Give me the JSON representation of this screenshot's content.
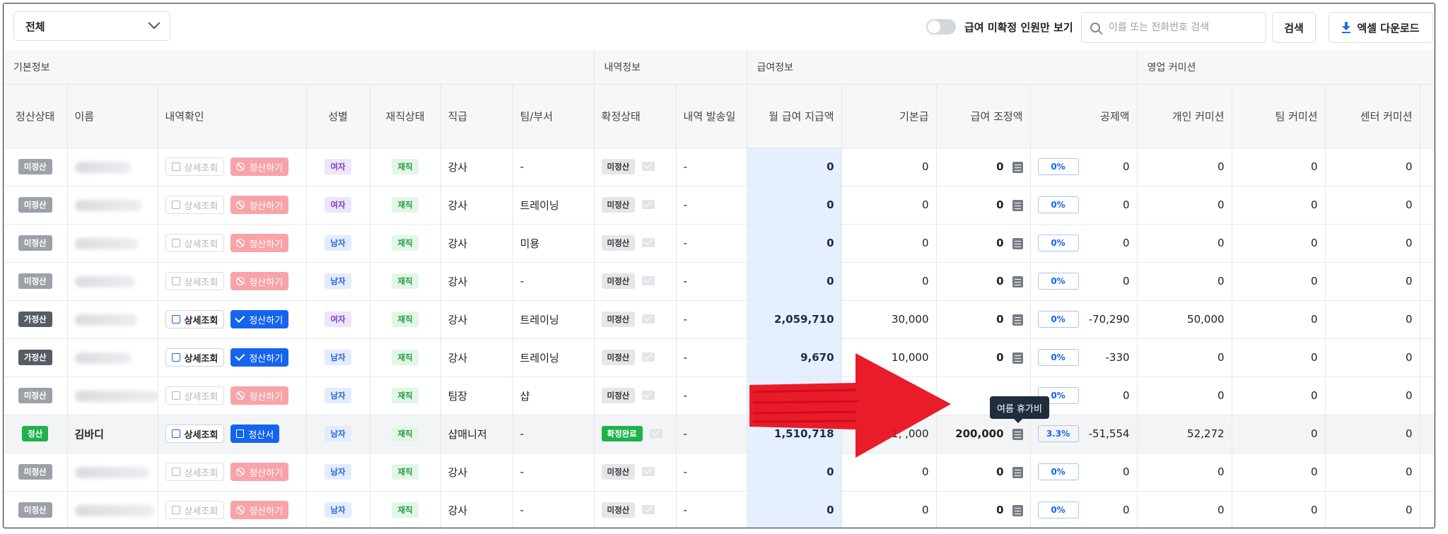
{
  "filter": {
    "selected": "전체"
  },
  "toggle": {
    "label": "급여 미확정 인원만 보기"
  },
  "search": {
    "placeholder": "이름 또는 전화번호 검색",
    "button_label": "검색"
  },
  "excel": {
    "label": "엑셀 다운로드"
  },
  "groups": [
    "기본정보",
    "내역정보",
    "급여정보",
    "영업 커미션"
  ],
  "columns": [
    "정산상태",
    "이름",
    "내역확인",
    "성별",
    "재직상태",
    "직급",
    "팀/부서",
    "확정상태",
    "내역 발송일",
    "월 급여 지급액",
    "기본급",
    "급여 조정액",
    "공제액",
    "개인 커미션",
    "팀 커미션",
    "센터 커미션"
  ],
  "action_labels": {
    "detail": "상세조회",
    "settle": "정산하기",
    "statement": "정산서"
  },
  "rows": [
    {
      "status": "미정산",
      "name": "",
      "gender": "여자",
      "emp": "재직",
      "rank": "강사",
      "team": "-",
      "confirm": "미정산",
      "sent": "-",
      "pay": "0",
      "base": "0",
      "adj": "0",
      "pct": "0%",
      "ded": "0",
      "pc": "0",
      "tc": "0",
      "cc": "0"
    },
    {
      "status": "미정산",
      "name": "",
      "gender": "여자",
      "emp": "재직",
      "rank": "강사",
      "team": "트레이닝",
      "confirm": "미정산",
      "sent": "-",
      "pay": "0",
      "base": "0",
      "adj": "0",
      "pct": "0%",
      "ded": "0",
      "pc": "0",
      "tc": "0",
      "cc": "0"
    },
    {
      "status": "미정산",
      "name": "",
      "gender": "남자",
      "emp": "재직",
      "rank": "강사",
      "team": "미용",
      "confirm": "미정산",
      "sent": "-",
      "pay": "0",
      "base": "0",
      "adj": "0",
      "pct": "0%",
      "ded": "0",
      "pc": "0",
      "tc": "0",
      "cc": "0"
    },
    {
      "status": "미정산",
      "name": "",
      "gender": "남자",
      "emp": "재직",
      "rank": "강사",
      "team": "-",
      "confirm": "미정산",
      "sent": "-",
      "pay": "0",
      "base": "0",
      "adj": "0",
      "pct": "0%",
      "ded": "0",
      "pc": "0",
      "tc": "0",
      "cc": "0"
    },
    {
      "status": "가정산",
      "name": "",
      "gender": "여자",
      "emp": "재직",
      "rank": "강사",
      "team": "트레이닝",
      "confirm": "미정산",
      "sent": "-",
      "pay": "2,059,710",
      "base": "30,000",
      "adj": "0",
      "pct": "0%",
      "ded": "-70,290",
      "pc": "50,000",
      "tc": "0",
      "cc": "0"
    },
    {
      "status": "가정산",
      "name": "",
      "gender": "남자",
      "emp": "재직",
      "rank": "강사",
      "team": "트레이닝",
      "confirm": "미정산",
      "sent": "-",
      "pay": "9,670",
      "base": "10,000",
      "adj": "0",
      "pct": "0%",
      "ded": "-330",
      "pc": "0",
      "tc": "0",
      "cc": "0"
    },
    {
      "status": "미정산",
      "name": "",
      "gender": "남자",
      "emp": "재직",
      "rank": "팀장",
      "team": "샵",
      "confirm": "미정산",
      "sent": "-",
      "pay": "",
      "base": "",
      "adj": "",
      "pct": "0%",
      "ded": "0",
      "pc": "0",
      "tc": "0",
      "cc": "0"
    },
    {
      "status": "정산",
      "name": "김바디",
      "gender": "남자",
      "emp": "재직",
      "rank": "샵매니저",
      "team": "-",
      "confirm": "확정완료",
      "sent": "-",
      "pay": "1,510,718",
      "base": "1,   ,000",
      "adj": "200,000",
      "pct": "3.3%",
      "ded": "-51,554",
      "pc": "52,272",
      "tc": "0",
      "cc": "0"
    },
    {
      "status": "미정산",
      "name": "",
      "gender": "남자",
      "emp": "재직",
      "rank": "강사",
      "team": "-",
      "confirm": "미정산",
      "sent": "-",
      "pay": "0",
      "base": "0",
      "adj": "0",
      "pct": "0%",
      "ded": "0",
      "pc": "0",
      "tc": "0",
      "cc": "0"
    },
    {
      "status": "미정산",
      "name": "",
      "gender": "남자",
      "emp": "재직",
      "rank": "강사",
      "team": "-",
      "confirm": "미정산",
      "sent": "-",
      "pay": "0",
      "base": "0",
      "adj": "0",
      "pct": "0%",
      "ded": "0",
      "pc": "0",
      "tc": "0",
      "cc": "0"
    }
  ],
  "tooltip": {
    "text": "여름 휴가비"
  },
  "colors": {
    "primary": "#1464f0",
    "danger_soft": "#f7a3a8",
    "success": "#1fb14b",
    "arrow": "#e8101e"
  }
}
